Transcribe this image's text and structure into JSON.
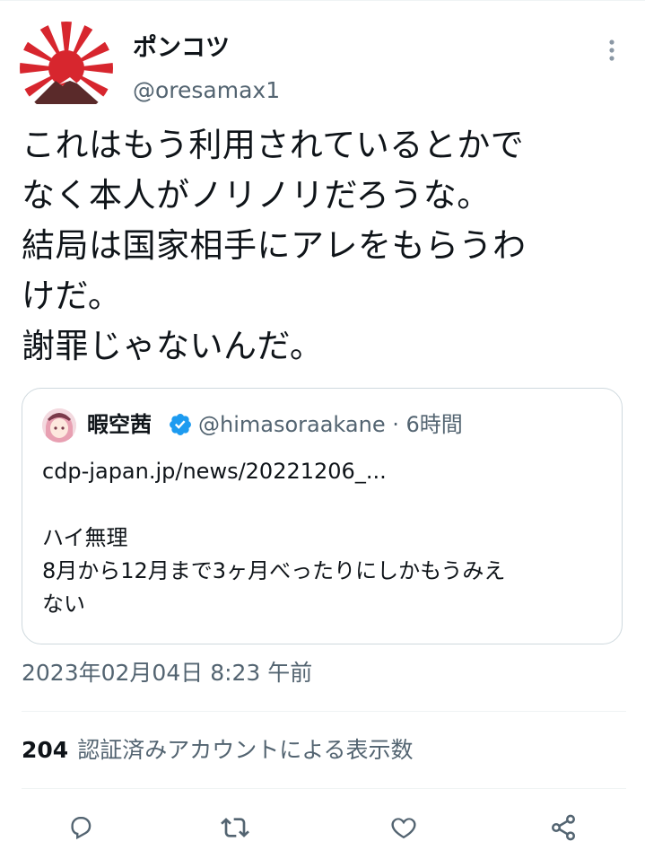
{
  "author": {
    "display_name": "ポンコツ",
    "handle": "@oresamax1",
    "avatar_icon": "rising-sun-flag-avatar"
  },
  "tweet": {
    "text": "これはもう利用されているとかで\nなく本人がノリノリだろうな。\n結局は国家相手にアレをもらうわ\nけだ。\n謝罪じゃないんだ。"
  },
  "quoted_tweet": {
    "display_name": "暇空茜",
    "handle_time": "@himasoraakane · 6時間",
    "text": "cdp-japan.jp/news/20221206_...\n\nハイ無理\n8月から12月まで3ヶ月べったりにしかもうみえ\nない"
  },
  "meta": {
    "timestamp": "2023年02月04日 8:23 午前",
    "views_count": "204",
    "views_label": "認証済みアカウントによる表示数"
  },
  "colors": {
    "text_primary": "#0f1419",
    "text_secondary": "#536471",
    "border": "#cfd9de",
    "verified": "#1d9bf0",
    "flag_red": "#d7262e"
  },
  "actions": [
    "reply-icon",
    "retweet-icon",
    "like-icon",
    "share-icon"
  ]
}
